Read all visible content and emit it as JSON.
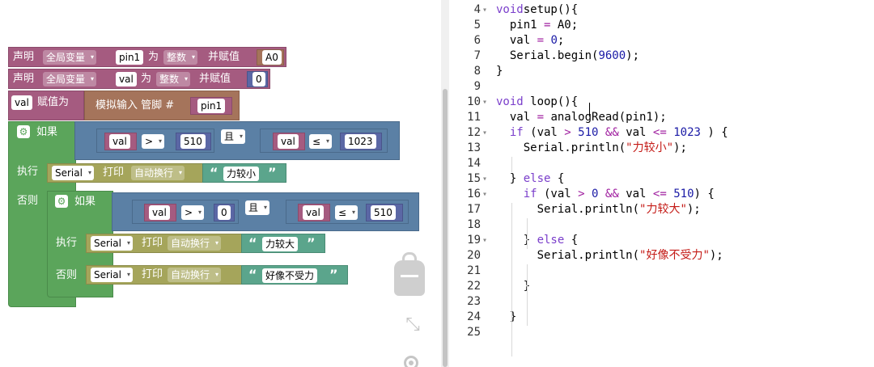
{
  "blocks": {
    "declare1": {
      "declare": "声明",
      "scope": "全局变量",
      "name": "pin1",
      "as": "为",
      "type": "整数",
      "assign": "并赋值",
      "value": "A0"
    },
    "declare2": {
      "declare": "声明",
      "scope": "全局变量",
      "name": "val",
      "as": "为",
      "type": "整数",
      "assign": "并赋值",
      "value": "0"
    },
    "set_val": {
      "var": "val",
      "assign": "赋值为",
      "read": "模拟输入 管脚 #",
      "pin": "pin1"
    },
    "if1": {
      "if": "如果",
      "cond_a": {
        "var": "val",
        "op": ">",
        "value": "510"
      },
      "and": "且",
      "cond_b": {
        "var": "val",
        "op": "≤",
        "value": "1023"
      },
      "do": "执行",
      "print": {
        "serial": "Serial",
        "action": "打印",
        "mode": "自动换行",
        "text": "力较小"
      },
      "else": "否则"
    },
    "if2": {
      "if": "如果",
      "cond_a": {
        "var": "val",
        "op": ">",
        "value": "0"
      },
      "and": "且",
      "cond_b": {
        "var": "val",
        "op": "≤",
        "value": "510"
      },
      "do": "执行",
      "print_do": {
        "serial": "Serial",
        "action": "打印",
        "mode": "自动换行",
        "text": "力较大"
      },
      "else": "否则",
      "print_else": {
        "serial": "Serial",
        "action": "打印",
        "mode": "自动换行",
        "text": "好像不受力"
      }
    },
    "quote_open": "“",
    "quote_close": "”",
    "dropdown_arrow": "▾"
  },
  "icons": {
    "gear": "⚙",
    "fold_open": "▾",
    "zoom_fit": "⤡"
  },
  "colors": {
    "variable": "#a55b80",
    "logic": "#5b80a5",
    "control": "#5ba55b",
    "serial": "#a5a55b",
    "text": "#5ba58c",
    "io": "#a5745b",
    "math": "#5b67a5"
  },
  "code": {
    "lines": [
      {
        "num": "4",
        "fold": "▾",
        "tokens": [
          [
            "kw",
            "void"
          ],
          [
            "",
            "setup(){"
          ]
        ]
      },
      {
        "num": "5",
        "fold": "",
        "tokens": [
          [
            "",
            "  pin1 "
          ],
          [
            "op",
            "="
          ],
          [
            "",
            " A0;"
          ]
        ]
      },
      {
        "num": "6",
        "fold": "",
        "tokens": [
          [
            "",
            "  val "
          ],
          [
            "op",
            "="
          ],
          [
            "",
            " "
          ],
          [
            "num",
            "0"
          ],
          [
            "",
            ";"
          ]
        ]
      },
      {
        "num": "7",
        "fold": "",
        "tokens": [
          [
            "",
            "  Serial.begin("
          ],
          [
            "num",
            "9600"
          ],
          [
            "",
            ");"
          ]
        ]
      },
      {
        "num": "8",
        "fold": "",
        "tokens": [
          [
            "",
            "}"
          ]
        ]
      },
      {
        "num": "9",
        "fold": "",
        "tokens": []
      },
      {
        "num": "10",
        "fold": "▾",
        "tokens": [
          [
            "kw",
            "void"
          ],
          [
            "",
            " loop(){"
          ]
        ]
      },
      {
        "num": "11",
        "fold": "",
        "tokens": [
          [
            "",
            "  val "
          ],
          [
            "op",
            "="
          ],
          [
            "",
            " analogRead(pin1);"
          ]
        ]
      },
      {
        "num": "12",
        "fold": "▾",
        "tokens": [
          [
            "",
            "  "
          ],
          [
            "kw",
            "if"
          ],
          [
            "",
            " (val "
          ],
          [
            "op",
            ">"
          ],
          [
            "",
            " "
          ],
          [
            "num",
            "510"
          ],
          [
            "",
            " "
          ],
          [
            "op",
            "&&"
          ],
          [
            "",
            " val "
          ],
          [
            "op",
            "<="
          ],
          [
            "",
            " "
          ],
          [
            "num",
            "1023"
          ],
          [
            "",
            " ) {"
          ]
        ]
      },
      {
        "num": "13",
        "fold": "",
        "tokens": [
          [
            "",
            "    Serial.println("
          ],
          [
            "str",
            "\"力较小\""
          ],
          [
            "",
            ");"
          ]
        ]
      },
      {
        "num": "14",
        "fold": "",
        "tokens": []
      },
      {
        "num": "15",
        "fold": "▾",
        "tokens": [
          [
            "",
            "  } "
          ],
          [
            "kw",
            "else"
          ],
          [
            "",
            " {"
          ]
        ]
      },
      {
        "num": "16",
        "fold": "▾",
        "tokens": [
          [
            "",
            "    "
          ],
          [
            "kw",
            "if"
          ],
          [
            "",
            " (val "
          ],
          [
            "op",
            ">"
          ],
          [
            "",
            " "
          ],
          [
            "num",
            "0"
          ],
          [
            "",
            " "
          ],
          [
            "op",
            "&&"
          ],
          [
            "",
            " val "
          ],
          [
            "op",
            "<="
          ],
          [
            "",
            " "
          ],
          [
            "num",
            "510"
          ],
          [
            "",
            ") {"
          ]
        ]
      },
      {
        "num": "17",
        "fold": "",
        "tokens": [
          [
            "",
            "      Serial.println("
          ],
          [
            "str",
            "\"力较大\""
          ],
          [
            "",
            ");"
          ]
        ]
      },
      {
        "num": "18",
        "fold": "",
        "tokens": []
      },
      {
        "num": "19",
        "fold": "▾",
        "tokens": [
          [
            "",
            "    } "
          ],
          [
            "kw",
            "else"
          ],
          [
            "",
            " {"
          ]
        ]
      },
      {
        "num": "20",
        "fold": "",
        "tokens": [
          [
            "",
            "      Serial.println("
          ],
          [
            "str",
            "\"好像不受力\""
          ],
          [
            "",
            ");"
          ]
        ]
      },
      {
        "num": "21",
        "fold": "",
        "tokens": []
      },
      {
        "num": "22",
        "fold": "",
        "tokens": [
          [
            "",
            "    }"
          ]
        ]
      },
      {
        "num": "23",
        "fold": "",
        "tokens": []
      },
      {
        "num": "24",
        "fold": "",
        "tokens": [
          [
            "",
            "  }"
          ]
        ]
      },
      {
        "num": "25",
        "fold": "",
        "tokens": []
      }
    ]
  }
}
